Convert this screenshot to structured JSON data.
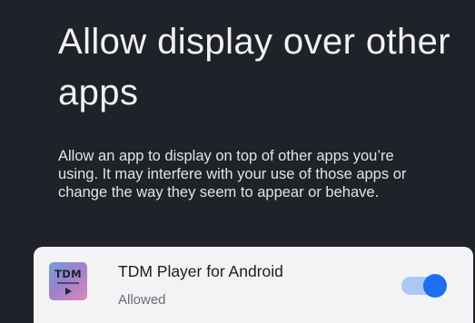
{
  "page": {
    "title": "Allow display over other apps",
    "description": "Allow an app to display on top of other apps you’re using. It may interfere with your use of those apps or change the way they seem to appear or behave."
  },
  "app_item": {
    "name": "TDM Player for Android",
    "status": "Allowed",
    "icon_text": "TDM",
    "icon": "tdm-player-app-icon",
    "toggle_on": true,
    "toggle_color": "#1d6ef0"
  },
  "colors": {
    "background": "#1f2229",
    "row_background": "#f3f3f6",
    "toggle_track": "#a9c8f6"
  }
}
